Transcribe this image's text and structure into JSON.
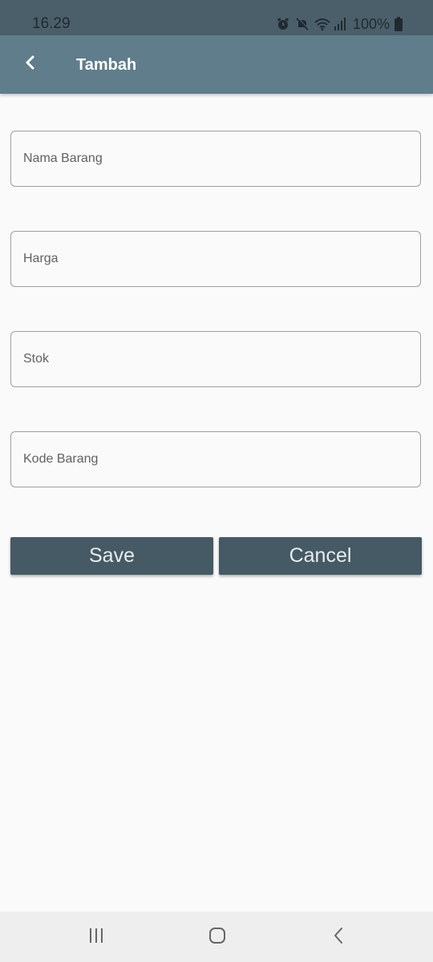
{
  "status_bar": {
    "time": "16.29",
    "battery": "100%",
    "icons": [
      "alarm-icon",
      "mute-icon",
      "wifi-icon",
      "signal-icon",
      "battery-icon"
    ]
  },
  "app_bar": {
    "title": "Tambah",
    "back_icon": "chevron-left-icon",
    "color": "#607d8b"
  },
  "form": {
    "fields": [
      {
        "name": "nama-barang",
        "value": "",
        "placeholder": "Nama Barang"
      },
      {
        "name": "harga",
        "value": "",
        "placeholder": "Harga"
      },
      {
        "name": "stok",
        "value": "",
        "placeholder": "Stok"
      },
      {
        "name": "kode-barang",
        "value": "",
        "placeholder": "Kode Barang"
      }
    ]
  },
  "buttons": {
    "save_label": "Save",
    "cancel_label": "Cancel",
    "color": "#455a64"
  },
  "nav_bar": {
    "icons": [
      "recent-apps-icon",
      "home-icon",
      "back-icon"
    ]
  }
}
